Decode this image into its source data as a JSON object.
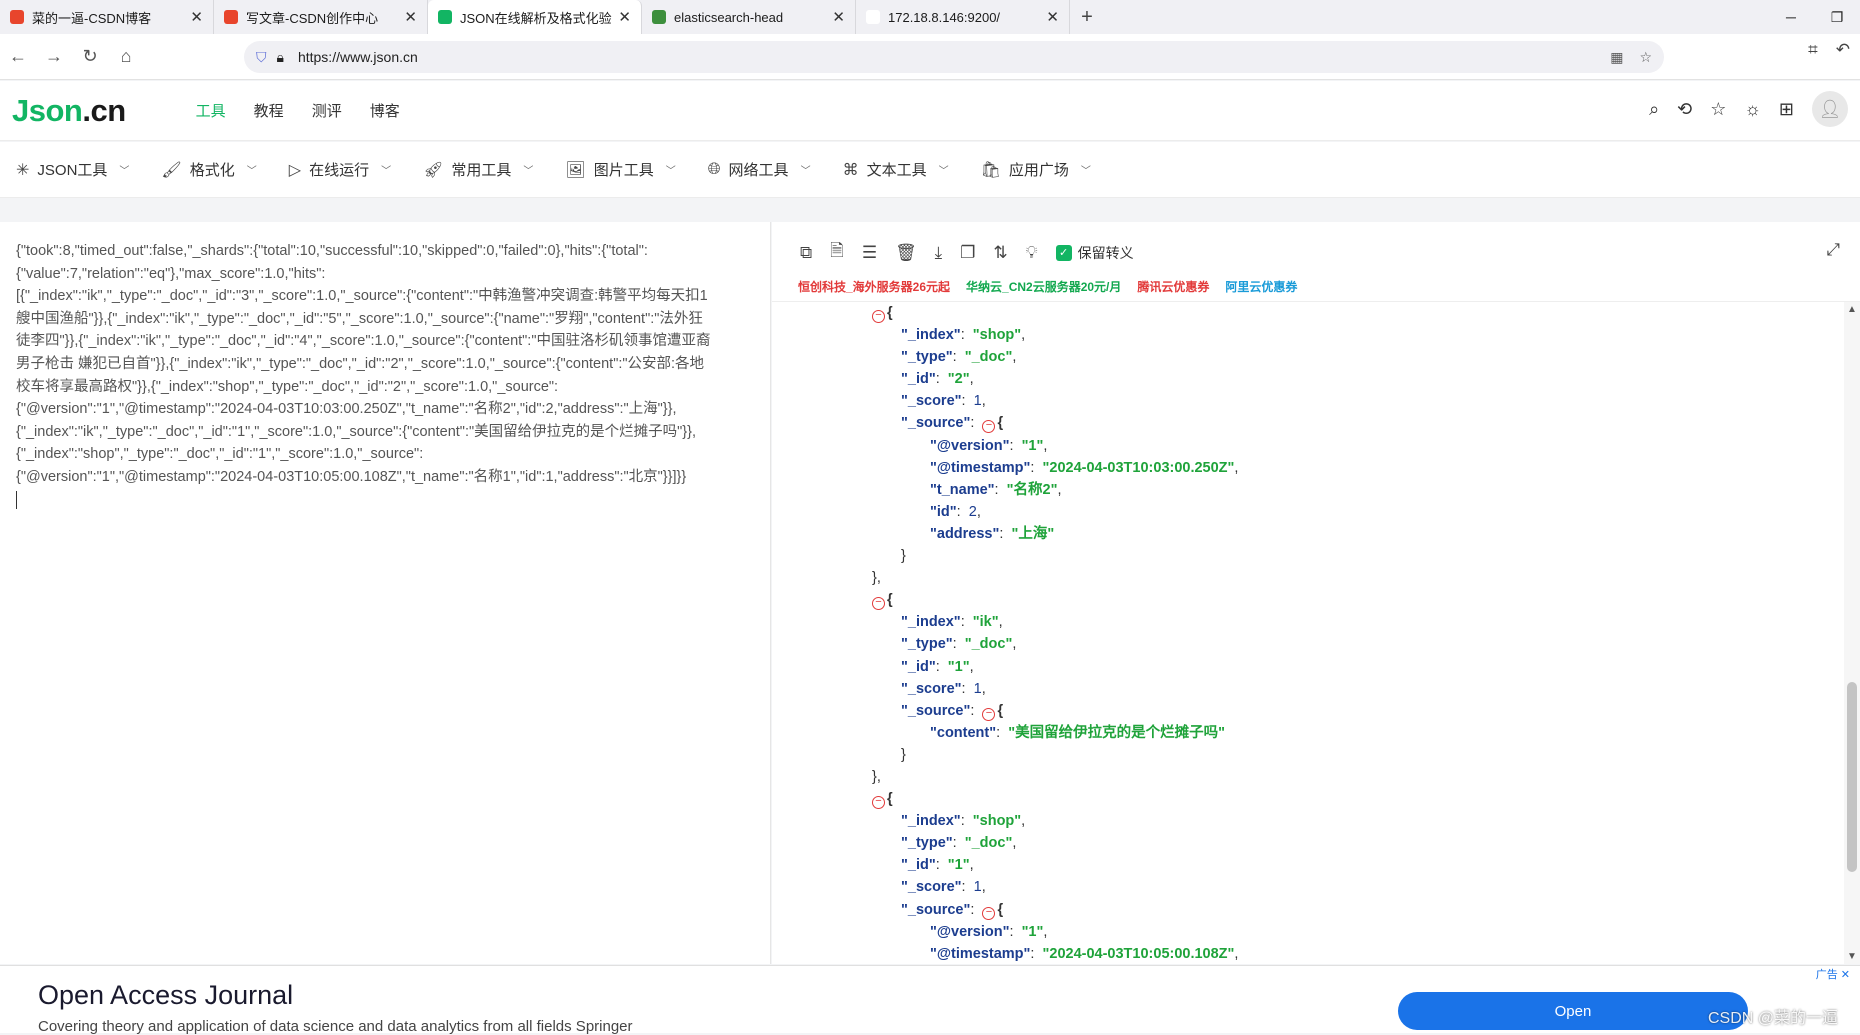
{
  "browser": {
    "tabs": [
      {
        "title": "菜的一逼-CSDN博客",
        "favicon_color": "#e8452c"
      },
      {
        "title": "写文章-CSDN创作中心",
        "favicon_color": "#e8452c"
      },
      {
        "title": "JSON在线解析及格式化验证 - J",
        "favicon_color": "#12b563"
      },
      {
        "title": "elasticsearch-head",
        "favicon_color": "#3d8f3d"
      },
      {
        "title": "172.18.8.146:9200/",
        "favicon_color": "#ffffff"
      }
    ],
    "url": "https://www.json.cn"
  },
  "site": {
    "logo_a": "Json",
    "logo_b": ".cn",
    "nav": [
      "工具",
      "教程",
      "测评",
      "博客"
    ]
  },
  "toolbar": [
    "JSON工具",
    "格式化",
    "在线运行",
    "常用工具",
    "图片工具",
    "网络工具",
    "文本工具",
    "应用广场"
  ],
  "raw_json": "{\"took\":8,\"timed_out\":false,\"_shards\":{\"total\":10,\"successful\":10,\"skipped\":0,\"failed\":0},\"hits\":{\"total\":\n{\"value\":7,\"relation\":\"eq\"},\"max_score\":1.0,\"hits\":\n[{\"_index\":\"ik\",\"_type\":\"_doc\",\"_id\":\"3\",\"_score\":1.0,\"_source\":{\"content\":\"中韩渔警冲突调查:韩警平均每天扣1\n艘中国渔船\"}},{\"_index\":\"ik\",\"_type\":\"_doc\",\"_id\":\"5\",\"_score\":1.0,\"_source\":{\"name\":\"罗翔\",\"content\":\"法外狂\n徒李四\"}},{\"_index\":\"ik\",\"_type\":\"_doc\",\"_id\":\"4\",\"_score\":1.0,\"_source\":{\"content\":\"中国驻洛杉矶领事馆遭亚裔\n男子枪击 嫌犯已自首\"}},{\"_index\":\"ik\",\"_type\":\"_doc\",\"_id\":\"2\",\"_score\":1.0,\"_source\":{\"content\":\"公安部:各地\n校车将享最高路权\"}},{\"_index\":\"shop\",\"_type\":\"_doc\",\"_id\":\"2\",\"_score\":1.0,\"_source\":\n{\"@version\":\"1\",\"@timestamp\":\"2024-04-03T10:03:00.250Z\",\"t_name\":\"名称2\",\"id\":2,\"address\":\"上海\"}},\n{\"_index\":\"ik\",\"_type\":\"_doc\",\"_id\":\"1\",\"_score\":1.0,\"_source\":{\"content\":\"美国留给伊拉克的是个烂摊子吗\"}},\n{\"_index\":\"shop\",\"_type\":\"_doc\",\"_id\":\"1\",\"_score\":1.0,\"_source\":\n{\"@version\":\"1\",\"@timestamp\":\"2024-04-03T10:05:00.108Z\",\"t_name\":\"名称1\",\"id\":1,\"address\":\"北京\"}}]}}",
  "right_panel": {
    "keep_escape": "保留转义",
    "promos": [
      {
        "text": "恒创科技_海外服务器26元起",
        "color": "#e23a3a"
      },
      {
        "text": "华纳云_CN2云服务器20元/月",
        "color": "#12a84f"
      },
      {
        "text": "腾讯云优惠券",
        "color": "#e23a3a"
      },
      {
        "text": "阿里云优惠券",
        "color": "#1a9bd8"
      }
    ]
  },
  "tree_lines": [
    {
      "indent": 1,
      "type": "open"
    },
    {
      "indent": 2,
      "key": "_index",
      "str": "shop",
      "comma": true
    },
    {
      "indent": 2,
      "key": "_type",
      "str": "_doc",
      "comma": true
    },
    {
      "indent": 2,
      "key": "_id",
      "str": "2",
      "comma": true
    },
    {
      "indent": 2,
      "key": "_score",
      "num": "1",
      "comma": true
    },
    {
      "indent": 2,
      "key": "_source",
      "type": "objopen"
    },
    {
      "indent": 3,
      "key": "@version",
      "str": "1",
      "comma": true
    },
    {
      "indent": 3,
      "key": "@timestamp",
      "str": "2024-04-03T10:03:00.250Z",
      "comma": true
    },
    {
      "indent": 3,
      "key": "t_name",
      "str": "名称2",
      "comma": true
    },
    {
      "indent": 3,
      "key": "id",
      "num": "2",
      "comma": true
    },
    {
      "indent": 3,
      "key": "address",
      "str": "上海",
      "comma": false
    },
    {
      "indent": 2,
      "type": "close",
      "text": "}"
    },
    {
      "indent": 1,
      "type": "close",
      "text": "},"
    },
    {
      "indent": 1,
      "type": "open"
    },
    {
      "indent": 2,
      "key": "_index",
      "str": "ik",
      "comma": true
    },
    {
      "indent": 2,
      "key": "_type",
      "str": "_doc",
      "comma": true
    },
    {
      "indent": 2,
      "key": "_id",
      "str": "1",
      "comma": true
    },
    {
      "indent": 2,
      "key": "_score",
      "num": "1",
      "comma": true
    },
    {
      "indent": 2,
      "key": "_source",
      "type": "objopen"
    },
    {
      "indent": 3,
      "key": "content",
      "str": "美国留给伊拉克的是个烂摊子吗",
      "comma": false
    },
    {
      "indent": 2,
      "type": "close",
      "text": "}"
    },
    {
      "indent": 1,
      "type": "close",
      "text": "},"
    },
    {
      "indent": 1,
      "type": "open"
    },
    {
      "indent": 2,
      "key": "_index",
      "str": "shop",
      "comma": true
    },
    {
      "indent": 2,
      "key": "_type",
      "str": "_doc",
      "comma": true
    },
    {
      "indent": 2,
      "key": "_id",
      "str": "1",
      "comma": true
    },
    {
      "indent": 2,
      "key": "_score",
      "num": "1",
      "comma": true
    },
    {
      "indent": 2,
      "key": "_source",
      "type": "objopen"
    },
    {
      "indent": 3,
      "key": "@version",
      "str": "1",
      "comma": true
    },
    {
      "indent": 3,
      "key": "@timestamp",
      "str": "2024-04-03T10:05:00.108Z",
      "comma": true
    }
  ],
  "ad": {
    "title": "Open Access Journal",
    "desc": "Covering theory and application of data science and data analytics from all fields Springer",
    "button": "Open",
    "tag": "广告 ✕"
  },
  "watermark": "CSDN @菜的一逼"
}
